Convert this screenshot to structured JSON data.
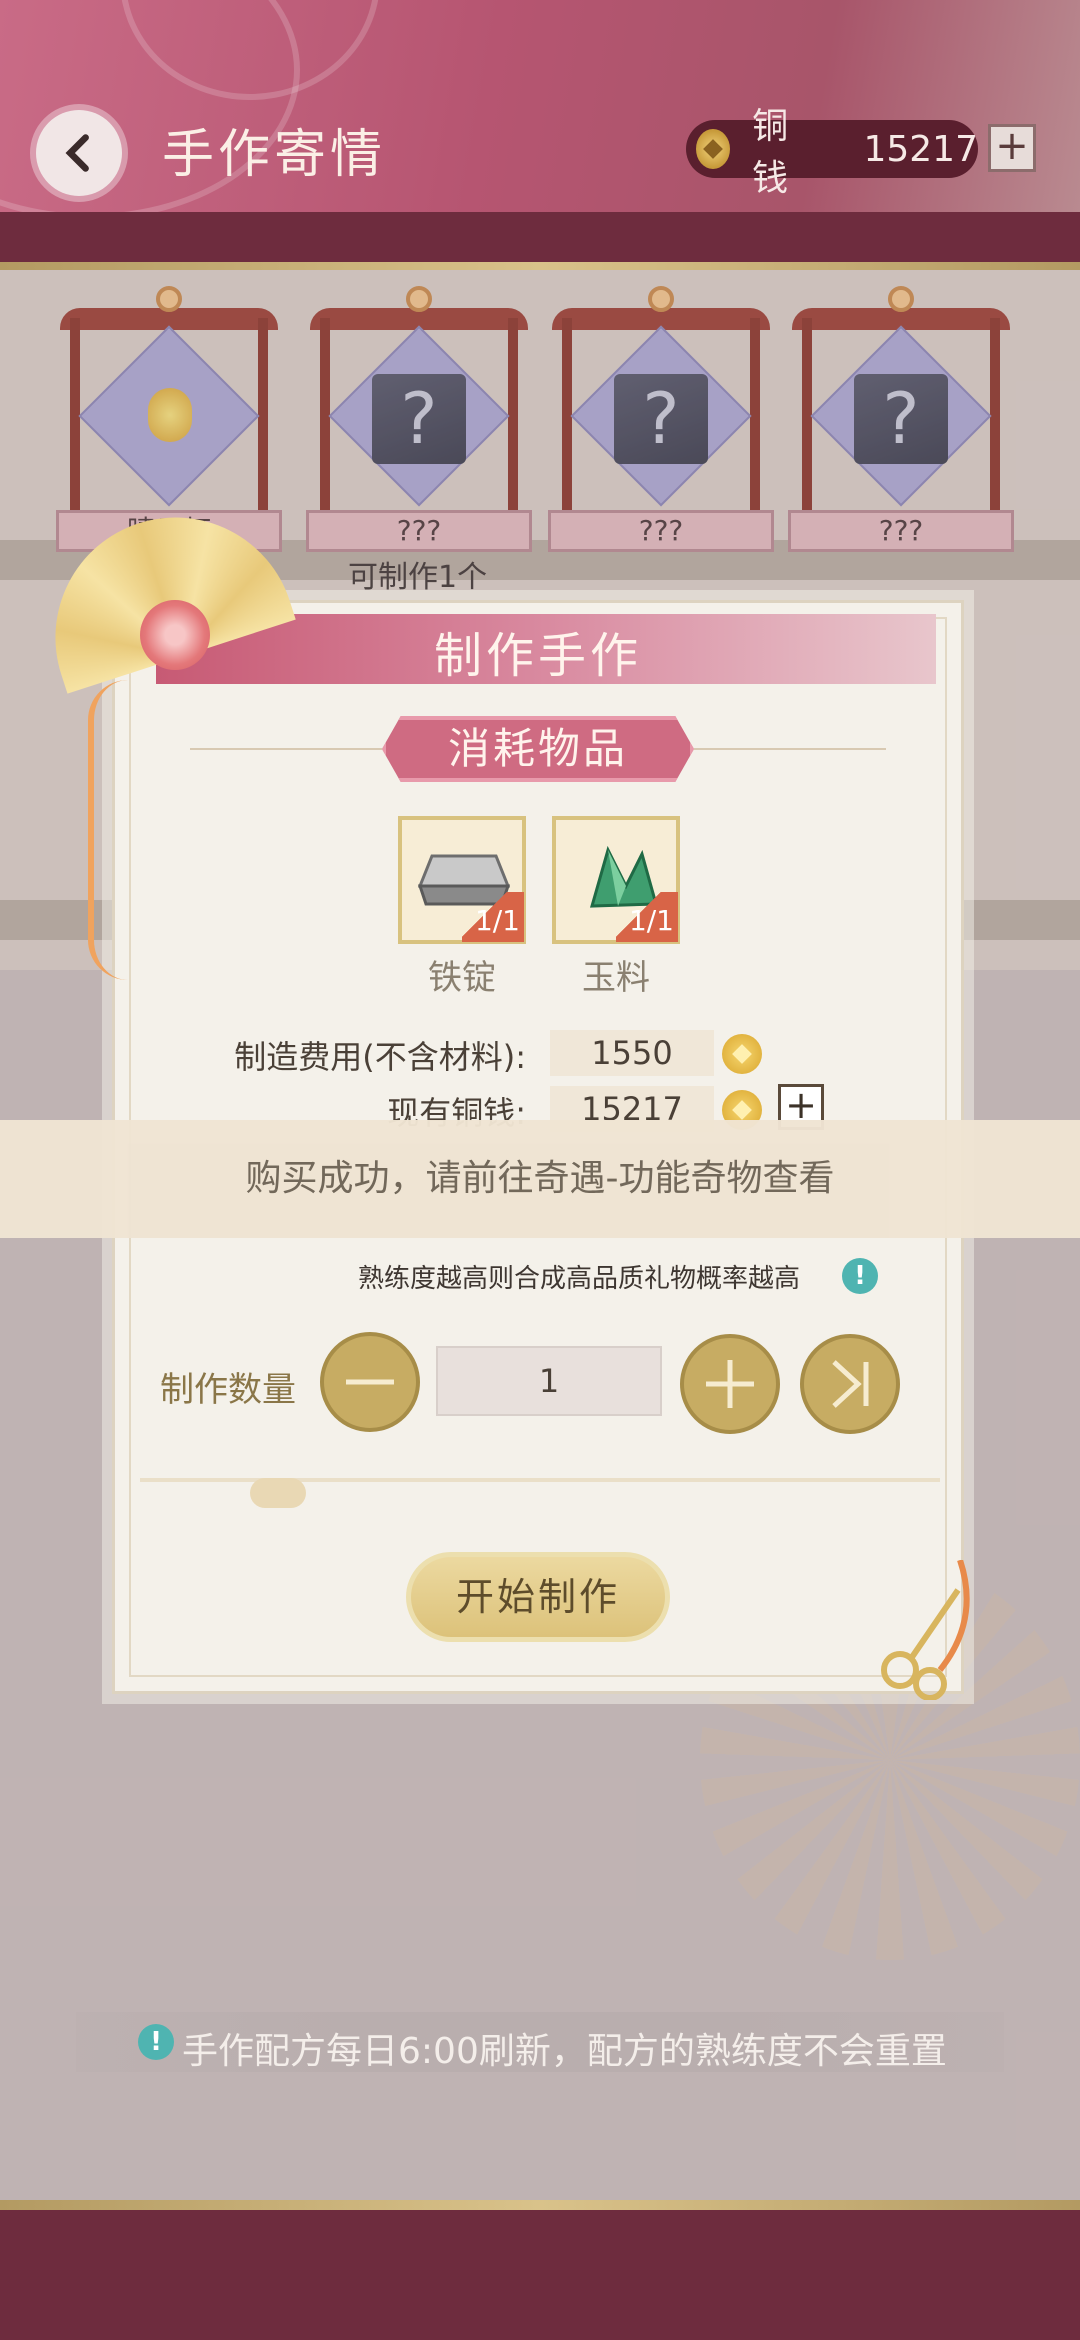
{
  "header": {
    "title": "手作寄情",
    "currency_label": "铜钱",
    "currency_value": "15217",
    "plus": "+"
  },
  "shelf": {
    "items": [
      {
        "name": "晴日灯",
        "icon": "lantern-icon"
      },
      {
        "name": "???",
        "icon": "mystery-box-icon"
      },
      {
        "name": "???",
        "icon": "mystery-box-icon"
      },
      {
        "name": "???",
        "icon": "mystery-box-icon"
      }
    ],
    "craftable": "可制作1个"
  },
  "dialog": {
    "title": "制作手作",
    "section": "消耗物品",
    "materials": [
      {
        "name": "铁锭",
        "count": "1/1",
        "icon": "iron-ingot-icon"
      },
      {
        "name": "玉料",
        "count": "1/1",
        "icon": "jade-icon"
      }
    ],
    "fee_label": "制造费用(不含材料):",
    "fee_value": "1550",
    "owned_label": "现有铜钱:",
    "owned_value": "15217",
    "plus": "+",
    "hint": "熟练度越高则合成高品质礼物概率越高",
    "info_mark": "!",
    "qty_label": "制作数量",
    "qty_value": "1",
    "start_button": "开始制作"
  },
  "toast": "购买成功，请前往奇遇-功能奇物查看",
  "notice": {
    "mark": "!",
    "text": "手作配方每日6:00刷新，配方的熟练度不会重置"
  },
  "colors": {
    "header": "#b65571",
    "band": "#6e2c3e",
    "accent_pink": "#cf6b82",
    "gold": "#c7ac63"
  }
}
